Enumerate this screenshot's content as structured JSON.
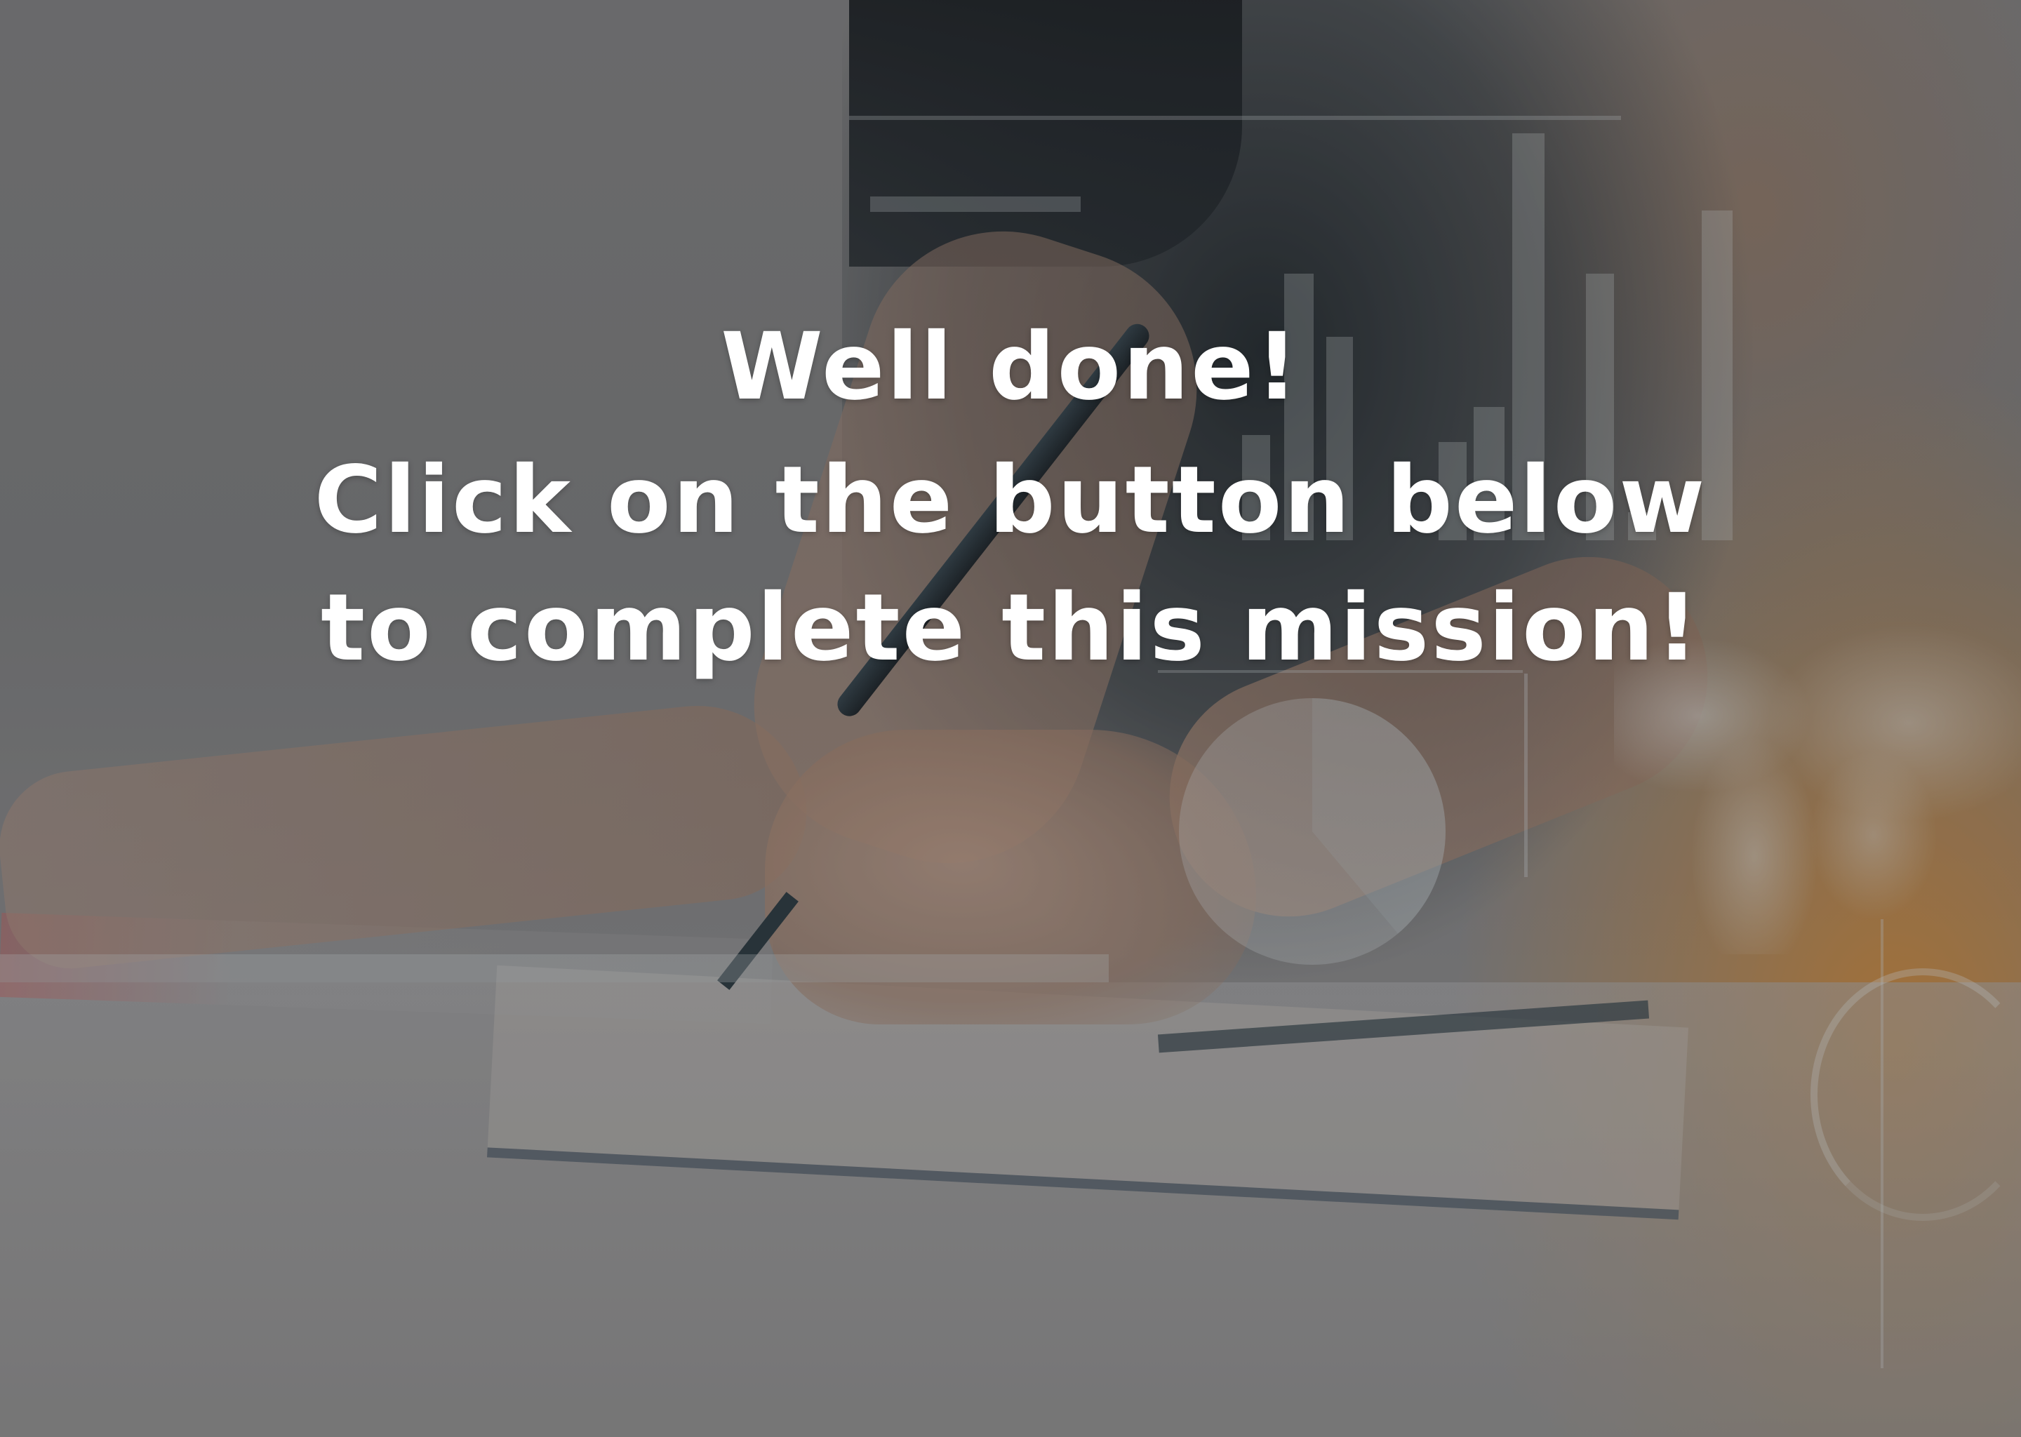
{
  "message": {
    "line1": "Well done!",
    "line2": "Click on the button below",
    "line3": "to complete this mission!"
  },
  "colors": {
    "text": "#ffffff",
    "accent_orange": "#d68428",
    "shirt_dark": "#141c22"
  }
}
